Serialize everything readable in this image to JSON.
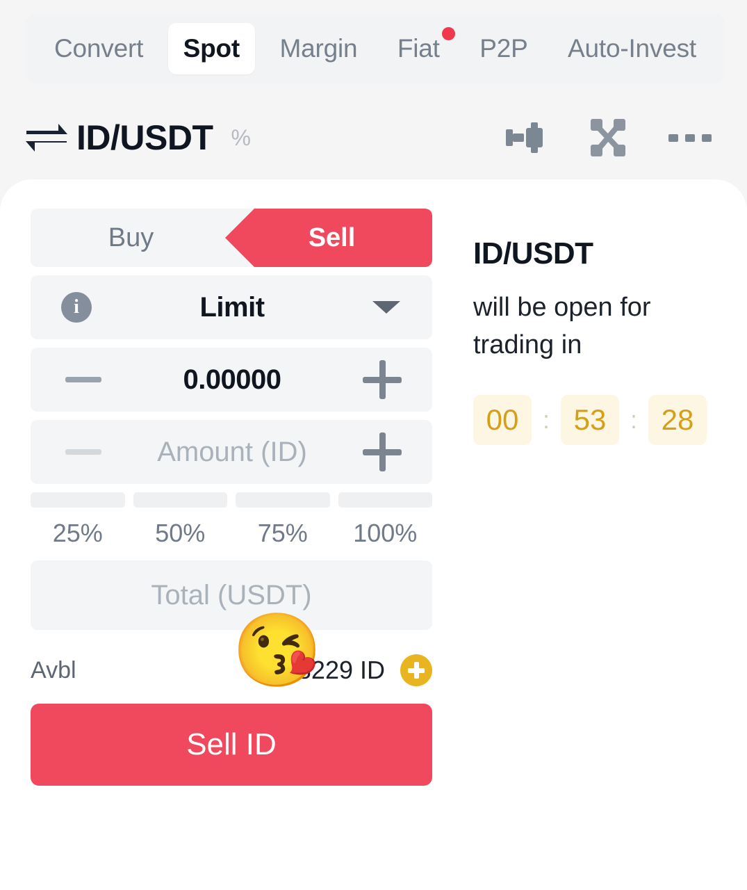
{
  "nav": {
    "tabs": [
      {
        "label": "Convert",
        "active": false,
        "badge": false
      },
      {
        "label": "Spot",
        "active": true,
        "badge": false
      },
      {
        "label": "Margin",
        "active": false,
        "badge": false
      },
      {
        "label": "Fiat",
        "active": false,
        "badge": true
      },
      {
        "label": "P2P",
        "active": false,
        "badge": false
      },
      {
        "label": "Auto-Invest",
        "active": false,
        "badge": false
      }
    ]
  },
  "pair_header": {
    "pair": "ID/USDT",
    "percent": "%",
    "icons": [
      "candlestick-chart-icon",
      "depth-chart-icon",
      "more-options-icon"
    ]
  },
  "order_form": {
    "side": {
      "buy_label": "Buy",
      "sell_label": "Sell",
      "selected": "Sell"
    },
    "order_type": {
      "label": "Limit",
      "info_glyph": "i",
      "caret": "chevron-down"
    },
    "price": {
      "value": "0.00000",
      "minus": "−",
      "plus": "+"
    },
    "amount": {
      "placeholder": "Amount (ID)",
      "value": "",
      "minus": "−",
      "plus": "+"
    },
    "percent_steps": [
      "25%",
      "50%",
      "75%",
      "100%"
    ],
    "total": {
      "placeholder": "Total (USDT)",
      "value": ""
    },
    "available": {
      "label": "Avbl",
      "value": "1 3 8229 ID",
      "unit": "ID",
      "add_funds": "+"
    },
    "submit_label": "Sell ID",
    "sticker": "😘"
  },
  "notice": {
    "pair": "ID/USDT",
    "message": "will be open for trading in",
    "countdown": {
      "hours": "00",
      "minutes": "53",
      "seconds": "28",
      "separator": ":"
    }
  },
  "colors": {
    "sell_red": "#f0485c",
    "badge_red": "#f0394d",
    "countdown_amber": "#d5a017",
    "countdown_bg": "#fdf6e3",
    "plus_badge_yellow": "#e8b520",
    "page_bg": "#f5f5f5"
  }
}
